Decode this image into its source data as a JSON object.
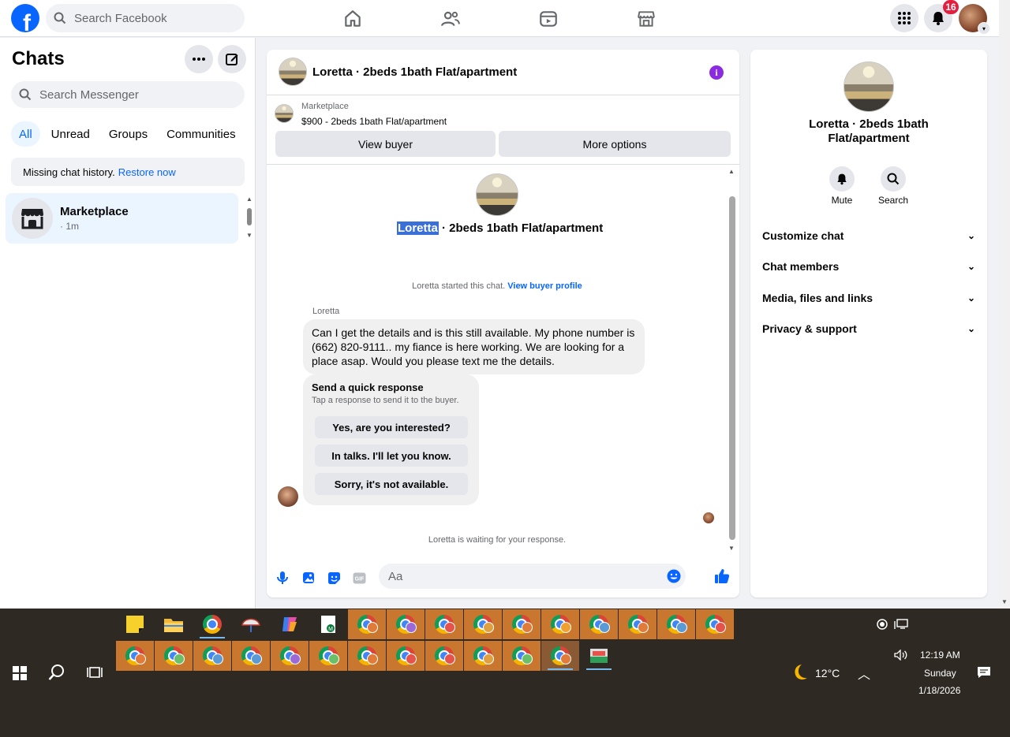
{
  "topbar": {
    "logo_letter": "f",
    "search_placeholder": "Search Facebook",
    "nav_icons": [
      "home-icon",
      "friends-icon",
      "video-icon",
      "marketplace-icon"
    ],
    "right_icons": [
      "menu-grid-icon",
      "notifications-bell-icon",
      "profile-avatar"
    ],
    "notification_count": "16"
  },
  "sidebar": {
    "title": "Chats",
    "search_placeholder": "Search Messenger",
    "filters": [
      "All",
      "Unread",
      "Groups",
      "Communities"
    ],
    "active_filter": "All",
    "missing_history_text": "Missing chat history.",
    "restore_link": "Restore now",
    "chats": [
      {
        "name": "Marketplace",
        "time": "· 1m"
      }
    ]
  },
  "conversation": {
    "title": "Loretta · 2beds 1bath Flat/apartment",
    "marketplace_label": "Marketplace",
    "listing": "$900 - 2beds 1bath Flat/apartment",
    "view_buyer": "View buyer",
    "more_options": "More options",
    "intro_name_selected": "Loretta",
    "intro_name_rest": " · 2beds 1bath Flat/apartment",
    "started_text": "Loretta started this chat.",
    "view_buyer_profile": "View buyer profile",
    "sender": "Loretta",
    "message": "Can I get the details and is this still available.  My phone number is (662) 820-9111.. my fiance is here working. We are looking for a place asap. Would you please text me the details.",
    "quick_title": "Send a quick response",
    "quick_sub": "Tap a response to send it to the buyer.",
    "quick_responses": [
      "Yes, are you interested?",
      "In talks. I'll let you know.",
      "Sorry, it's not available."
    ],
    "waiting": "Loretta is waiting for your response.",
    "composer_placeholder": "Aa"
  },
  "details": {
    "title": "Loretta · 2beds 1bath Flat/apartment",
    "mute": "Mute",
    "search": "Search",
    "sections": [
      "Customize chat",
      "Chat members",
      "Media, files and links",
      "Privacy & support"
    ]
  },
  "taskbar": {
    "temperature": "12°C",
    "time": "12:19 AM",
    "day": "Sunday",
    "date": "1/18/2026"
  },
  "colors": {
    "accent": "#0866ff",
    "selected_chat_bg": "#ebf5ff",
    "taskbar_bg": "#2e2a23",
    "taskbar_app_bg": "#c9772f",
    "badge": "#e41e3f"
  }
}
